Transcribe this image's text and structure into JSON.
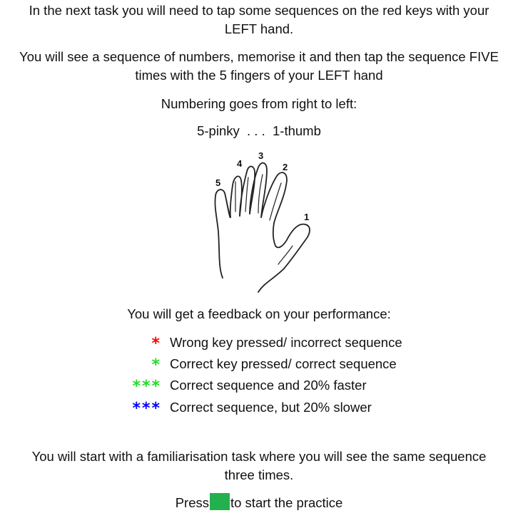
{
  "intro": {
    "line1": "In the next task you will need to tap some sequences on the red keys with your",
    "line2": "LEFT hand.",
    "line3": "You will see a sequence of numbers, memorise it and then tap the sequence FIVE",
    "line4": "times with the 5 fingers of your LEFT hand",
    "numbering": "Numbering goes from right to left:",
    "range": "5-pinky  . . .  1-thumb"
  },
  "hand": {
    "finger_labels": [
      "5",
      "4",
      "3",
      "2",
      "1"
    ]
  },
  "feedback": {
    "heading": "You will get a feedback on your performance:",
    "items": [
      {
        "stars": "*",
        "color": "#ff0000",
        "label": "Wrong key pressed/ incorrect sequence"
      },
      {
        "stars": "*",
        "color": "#22dd22",
        "label": "Correct key pressed/ correct sequence"
      },
      {
        "stars": "***",
        "color": "#22dd22",
        "label": "Correct sequence and 20% faster"
      },
      {
        "stars": "***",
        "color": "#0000ff",
        "label": "Correct sequence, but 20% slower"
      }
    ]
  },
  "familiarisation": {
    "line1": "You will start with a familiarisation task where you will see the same sequence",
    "line2": "three times."
  },
  "start": {
    "before": "Press",
    "after": "to start the practice",
    "key_color": "#22b14c"
  }
}
